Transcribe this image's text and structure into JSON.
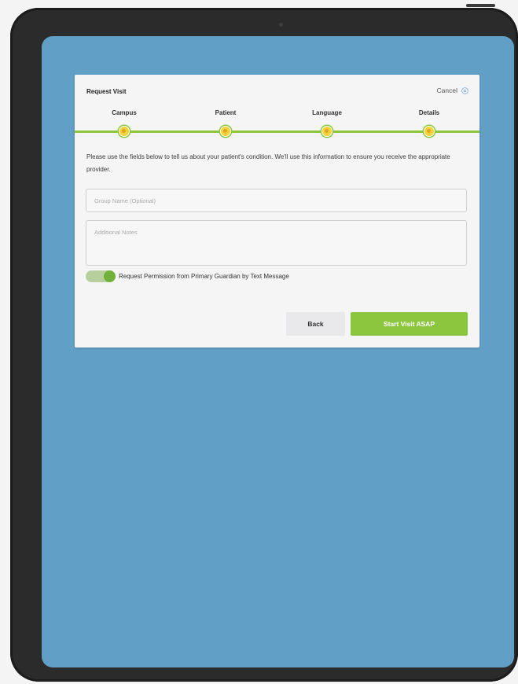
{
  "dialog": {
    "title": "Request Visit",
    "cancel_label": "Cancel"
  },
  "steps": [
    {
      "label": "Campus"
    },
    {
      "label": "Patient"
    },
    {
      "label": "Language"
    },
    {
      "label": "Details"
    }
  ],
  "form": {
    "description": "Please use the fields below to tell us about your patient's condition. We'll use this information to ensure you receive the appropriate provider.",
    "group_name_placeholder": "Group Name (Optional)",
    "group_name_value": "",
    "notes_placeholder": "Additional Notes",
    "notes_value": "",
    "permission_toggle_label": "Request Permission from Primary Guardian by Text Message",
    "permission_toggle_on": true
  },
  "buttons": {
    "back_label": "Back",
    "start_label": "Start Visit ASAP"
  },
  "colors": {
    "accent_green": "#8cc63f",
    "screen_background": "#619fc6",
    "step_marker": "#f3d23a"
  }
}
